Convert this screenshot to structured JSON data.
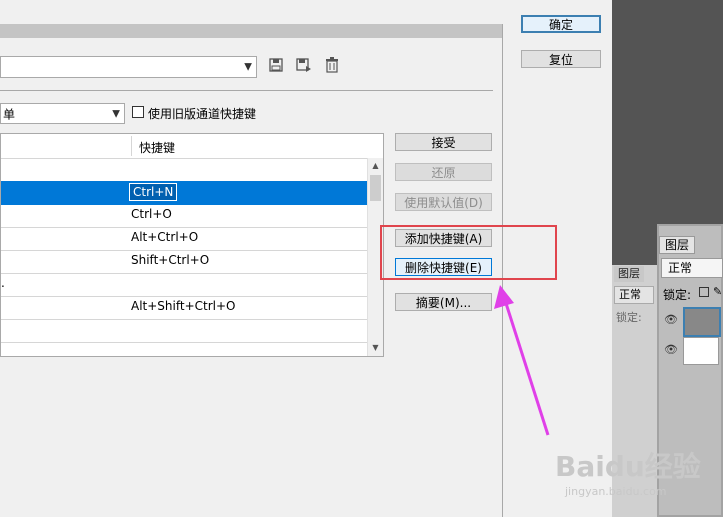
{
  "buttons": {
    "ok": "确定",
    "reset": "复位",
    "accept": "接受",
    "undo": "还原",
    "use_default": "使用默认值(D)",
    "add_shortcut": "添加快捷键(A)",
    "delete_shortcut": "删除快捷键(E)",
    "summary": "摘要(M)..."
  },
  "shortcuts_for": {
    "value": "单"
  },
  "legacy_channel_checkbox": {
    "label": "使用旧版通道快捷键",
    "checked": false
  },
  "table": {
    "column_shortcut": "快捷键",
    "rows": [
      {
        "command": "",
        "shortcut": "",
        "group": true
      },
      {
        "command": "",
        "shortcut": "Ctrl+N",
        "selected": true
      },
      {
        "command": "",
        "shortcut": "Ctrl+O"
      },
      {
        "command": "",
        "shortcut": "Alt+Ctrl+O"
      },
      {
        "command": "",
        "shortcut": "Shift+Ctrl+O"
      },
      {
        "command": ".",
        "shortcut": ""
      },
      {
        "command": "",
        "shortcut": "Alt+Shift+Ctrl+O"
      },
      {
        "command": "",
        "shortcut": ""
      },
      {
        "command": "",
        "shortcut": ""
      }
    ]
  },
  "photoshop_panel": {
    "layers_tab": "图层",
    "layers_tab_back": "图层",
    "blend_mode": "正常",
    "blend_mode_back": "正常",
    "lock_label": "锁定:",
    "lock_label_back": "锁定:"
  },
  "watermark": {
    "brand": "Baidu经验",
    "url": "jingyan.baidu.com"
  },
  "colors": {
    "selection": "#0078d7",
    "annotation_box": "#e0454d",
    "annotation_arrow": "#e040e8"
  }
}
